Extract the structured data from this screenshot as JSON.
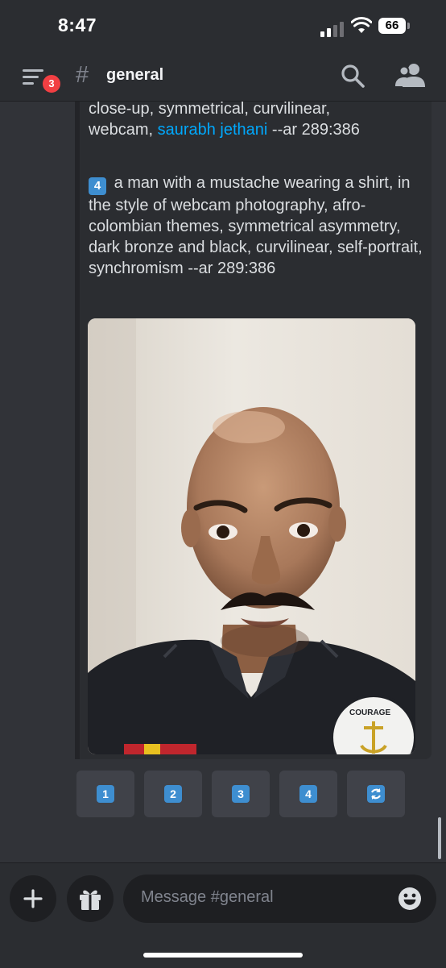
{
  "status_bar": {
    "time": "8:47",
    "battery": "66"
  },
  "header": {
    "notification_count": "3",
    "hash_symbol": "#",
    "channel_name": "general"
  },
  "message": {
    "line1": "close-up, symmetrical, curvilinear,",
    "line2_prefix": "webcam, ",
    "link_text": "saurabh jethani",
    "line2_suffix": " --ar 289:386",
    "prompt_number": "4",
    "prompt_text": "a man with a mustache wearing a shirt, in the style of webcam photography, afro-colombian themes, symmetrical asymmetry, dark bronze and black, curvilinear, self-portrait, synchromism --ar 289:386",
    "image_shirt_text": "COURAGE"
  },
  "action_buttons": [
    {
      "label": "1"
    },
    {
      "label": "2"
    },
    {
      "label": "3"
    },
    {
      "label": "4"
    },
    {
      "icon": "refresh-icon"
    }
  ],
  "composer": {
    "placeholder": "Message #general"
  },
  "colors": {
    "link": "#00a8fc",
    "badge": "#f23f43",
    "keycap": "#3e8ed0",
    "background": "#313338"
  }
}
